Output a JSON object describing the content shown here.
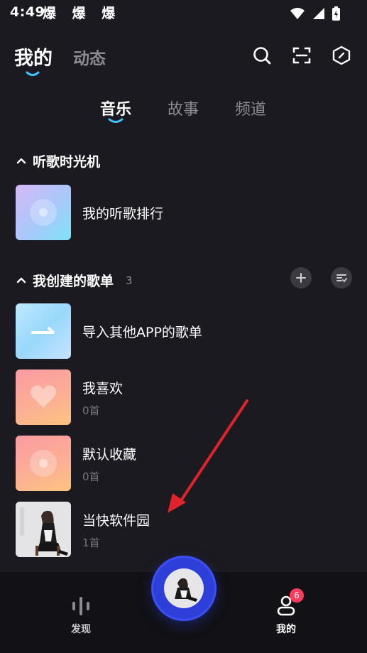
{
  "status": {
    "time": "4:49",
    "extra": "爆 爆 爆"
  },
  "top_nav": {
    "tabs": [
      "我的",
      "动态"
    ]
  },
  "sub_tabs": [
    "音乐",
    "故事",
    "频道"
  ],
  "sections": {
    "time_machine": {
      "title": "听歌时光机",
      "items": [
        {
          "title": "我的听歌排行"
        }
      ]
    },
    "created": {
      "title": "我创建的歌单",
      "count": "3",
      "items": [
        {
          "title": "导入其他APP的歌单",
          "subtitle": ""
        },
        {
          "title": "我喜欢",
          "subtitle": "0首"
        },
        {
          "title": "默认收藏",
          "subtitle": "0首"
        },
        {
          "title": "当快软件园",
          "subtitle": "1首"
        }
      ]
    }
  },
  "bottom_nav": {
    "items": [
      {
        "label": "发现"
      },
      {
        "label": "我的"
      }
    ],
    "badge": "6"
  },
  "icons": {
    "search": "search-icon",
    "scan": "scan-icon",
    "settings": "hexagon-icon",
    "add": "plus-icon",
    "manage": "list-sort-icon",
    "discover": "equalizer-icon",
    "profile": "user-icon"
  },
  "colors": {
    "accent": "#40c6ff",
    "background": "#1b1a20",
    "badge": "#ff3b5c",
    "center_disc": "#2e3fd9",
    "arrow": "#e0232b"
  }
}
